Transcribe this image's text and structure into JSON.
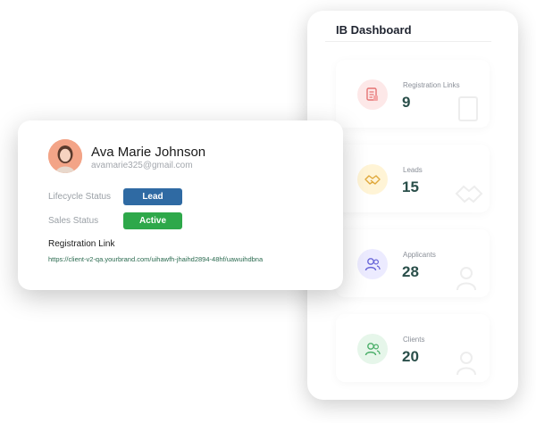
{
  "dashboard": {
    "title": "IB Dashboard",
    "stats": [
      {
        "label": "Registration Links",
        "value": "9",
        "icon": "document-list-icon",
        "bg": "#fde8e8",
        "color": "#e57373"
      },
      {
        "label": "Leads",
        "value": "15",
        "icon": "handshake-icon",
        "bg": "#fff4d6",
        "color": "#e0a83b"
      },
      {
        "label": "Applicants",
        "value": "28",
        "icon": "users-icon",
        "bg": "#ecebff",
        "color": "#6a67d8"
      },
      {
        "label": "Clients",
        "value": "20",
        "icon": "user-group-icon",
        "bg": "#e6f6ea",
        "color": "#4caf6a"
      }
    ]
  },
  "profile": {
    "name": "Ava Marie Johnson",
    "email": "avamarie325@gmail.com",
    "lifecycle_label": "Lifecycle Status",
    "lifecycle_value": "Lead",
    "lifecycle_color": "#2f6aa3",
    "sales_label": "Sales Status",
    "sales_value": "Active",
    "sales_color": "#2ea84a",
    "registration_title": "Registration Link",
    "registration_url": "https://client-v2-qa.yourbrand.com/uihawfh-jhaihd2894-48hf/uawuihdbna"
  }
}
